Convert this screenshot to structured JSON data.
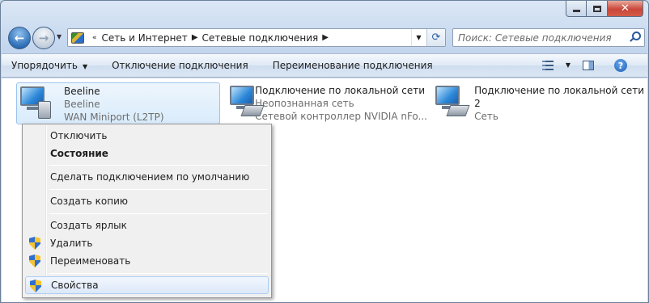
{
  "window": {
    "caption": {
      "minimize": "",
      "maximize": "",
      "close": "✕"
    }
  },
  "nav": {
    "back": "←",
    "forward": "→",
    "breadcrumb": [
      "Сеть и Интернет",
      "Сетевые подключения"
    ],
    "search_placeholder": "Поиск: Сетевые подключения"
  },
  "toolbar": {
    "organize_label": "Упорядочить",
    "disconnect_label": "Отключение подключения",
    "rename_label": "Переименование подключения"
  },
  "connections": [
    {
      "name": "Beeline",
      "line2": "Beeline",
      "line3": "WAN Miniport (L2TP)"
    },
    {
      "name": "Подключение по локальной сети",
      "line2": "Неопознанная сеть",
      "line3": "Сетевой контроллер NVIDIA nFo..."
    },
    {
      "name": "Подключение по локальной сети",
      "name_line2": "2",
      "line3": "Сеть"
    }
  ],
  "context_menu": {
    "items": [
      {
        "label": "Отключить"
      },
      {
        "label": "Состояние"
      },
      {
        "label": "Сделать подключением по умолчанию"
      },
      {
        "label": "Создать копию"
      },
      {
        "label": "Создать ярлык"
      },
      {
        "label": "Удалить"
      },
      {
        "label": "Переименовать"
      },
      {
        "label": "Свойства"
      }
    ]
  }
}
